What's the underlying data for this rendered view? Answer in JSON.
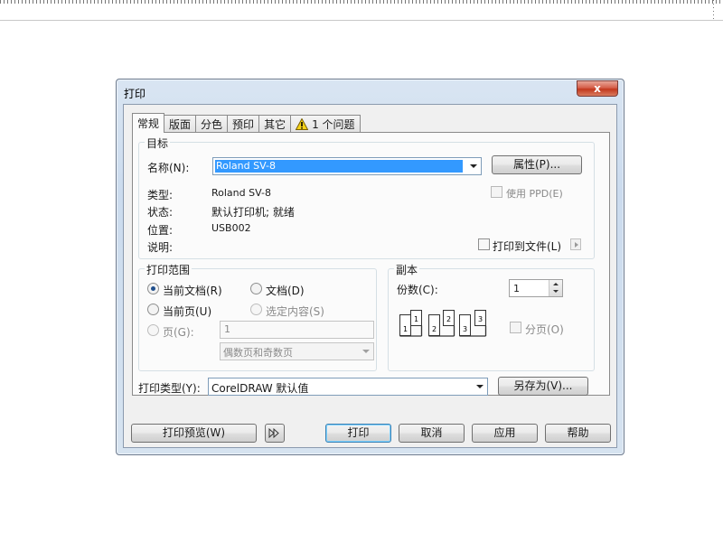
{
  "dialog": {
    "title": "打印",
    "close_label": "x",
    "tabs": [
      {
        "label": "常规",
        "active": true
      },
      {
        "label": "版面"
      },
      {
        "label": "分色"
      },
      {
        "label": "预印"
      },
      {
        "label": "其它"
      },
      {
        "label": "1 个问题",
        "icon": "warning-icon"
      }
    ]
  },
  "target": {
    "group_label": "目标",
    "name_label": "名称(N):",
    "printer_value": "Roland SV-8",
    "properties_button": "属性(P)...",
    "type_label": "类型:",
    "type_value": "Roland SV-8",
    "status_label": "状态:",
    "status_value": "默认打印机; 就绪",
    "location_label": "位置:",
    "location_value": "USB002",
    "comment_label": "说明:",
    "use_ppd_label": "使用 PPD(E)",
    "print_to_file_label": "打印到文件(L)"
  },
  "print_range": {
    "group_label": "打印范围",
    "current_document": "当前文档(R)",
    "documents": "文档(D)",
    "current_page": "当前页(U)",
    "selection": "选定内容(S)",
    "pages": "页(G):",
    "pages_value": "1",
    "page_set": "偶数页和奇数页",
    "selected": "current_document"
  },
  "copies": {
    "group_label": "副本",
    "count_label": "份数(C):",
    "count_value": "1",
    "collate_label": "分页(O)"
  },
  "print_style": {
    "label": "打印类型(Y):",
    "value": "CorelDRAW 默认值",
    "save_as_button": "另存为(V)..."
  },
  "footer": {
    "preview_button": "打印预览(W)",
    "print_button": "打印",
    "cancel_button": "取消",
    "apply_button": "应用",
    "help_button": "帮助"
  },
  "colors": {
    "selection": "#3399ff",
    "close_button": "#c2381e",
    "default_button_border": "#3c7fb1"
  }
}
